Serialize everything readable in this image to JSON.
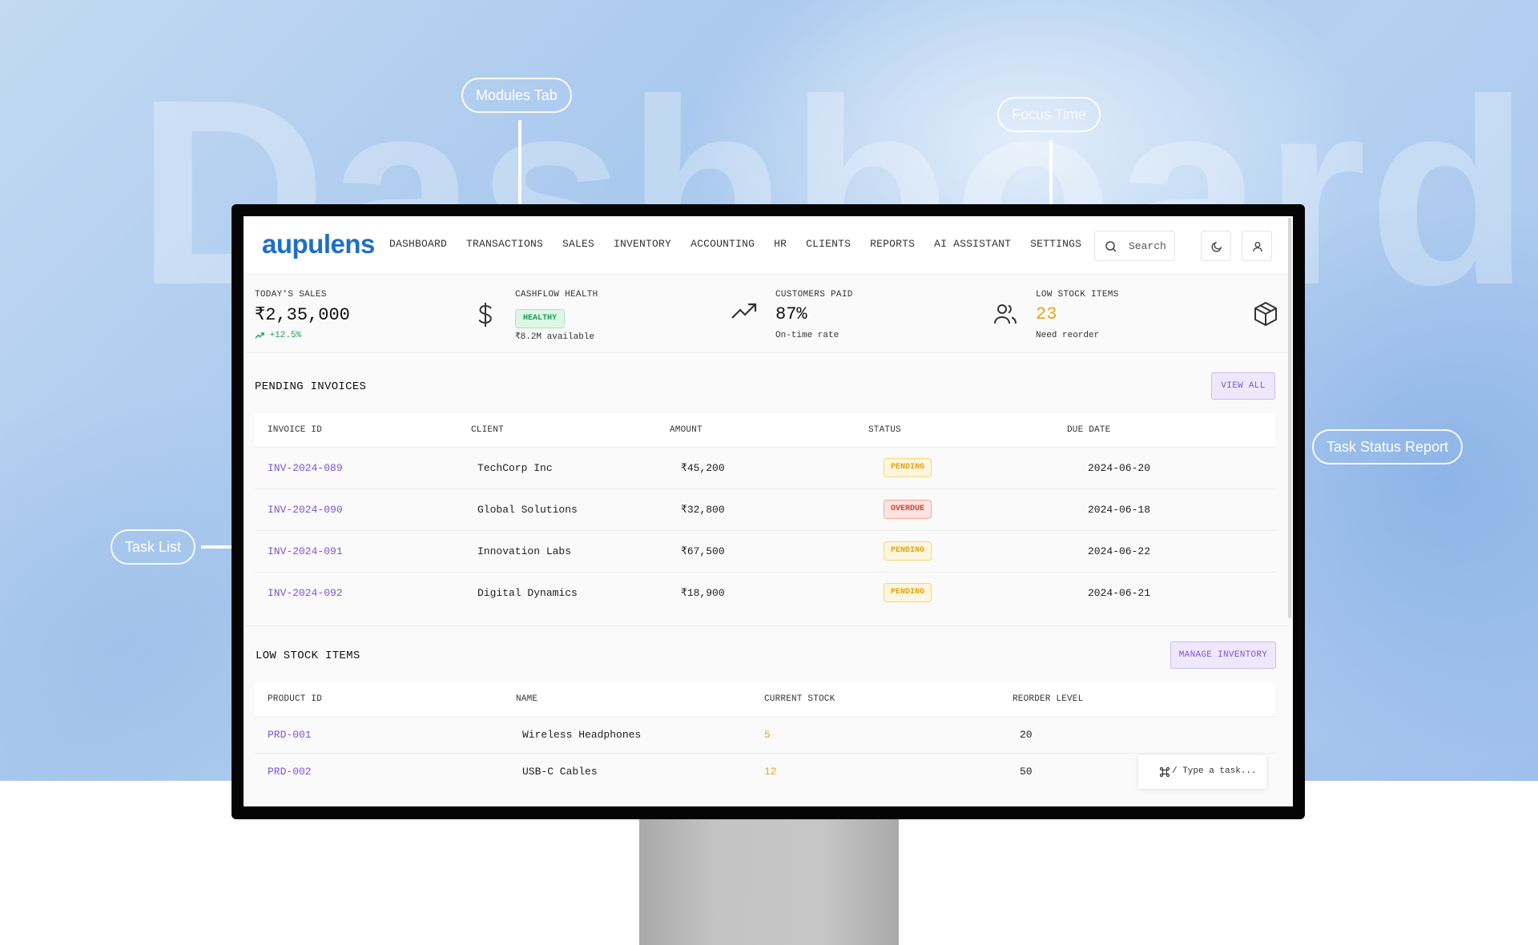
{
  "banner": {
    "watermark": "Dashboard",
    "callouts": {
      "modules_tab": "Modules Tab",
      "focus_time": "Focus Time",
      "task_status_report": "Task Status Report",
      "task_list": "Task List"
    }
  },
  "app": {
    "logo": "aupulens",
    "nav": [
      "DASHBOARD",
      "TRANSACTIONS",
      "SALES",
      "INVENTORY",
      "ACCOUNTING",
      "HR",
      "CLIENTS",
      "REPORTS",
      "AI ASSISTANT",
      "SETTINGS"
    ],
    "search_placeholder": "Search",
    "icons": {
      "search": "search-icon",
      "theme": "moon-icon",
      "profile": "user-icon"
    }
  },
  "stats": {
    "todays_sales": {
      "label": "TODAY'S SALES",
      "value": "₹2,35,000",
      "change": "+12.5%",
      "icon": "dollar-icon"
    },
    "cashflow": {
      "label": "CASHFLOW HEALTH",
      "badge": "HEALTHY",
      "sub": "₹8.2M available",
      "icon": "trending-up-icon"
    },
    "customers_paid": {
      "label": "CUSTOMERS PAID",
      "value": "87%",
      "sub": "On-time rate",
      "icon": "users-icon"
    },
    "low_stock": {
      "label": "LOW STOCK ITEMS",
      "value": "23",
      "sub": "Need reorder",
      "icon": "box-icon"
    }
  },
  "colors": {
    "accent": "#7b55d1",
    "brand": "#1e6ec8",
    "pending": "#e0a412",
    "overdue": "#d2432f",
    "healthy": "#1f9d55",
    "low_stock": "#e9a51a"
  },
  "pending_invoices": {
    "title": "PENDING INVOICES",
    "view_all": "VIEW ALL",
    "columns": [
      "INVOICE ID",
      "CLIENT",
      "AMOUNT",
      "STATUS",
      "DUE DATE"
    ],
    "rows": [
      {
        "id": "INV-2024-089",
        "client": "TechCorp Inc",
        "amount": "₹45,200",
        "status": "PENDING",
        "due": "2024-06-20"
      },
      {
        "id": "INV-2024-090",
        "client": "Global Solutions",
        "amount": "₹32,800",
        "status": "OVERDUE",
        "due": "2024-06-18"
      },
      {
        "id": "INV-2024-091",
        "client": "Innovation Labs",
        "amount": "₹67,500",
        "status": "PENDING",
        "due": "2024-06-22"
      },
      {
        "id": "INV-2024-092",
        "client": "Digital Dynamics",
        "amount": "₹18,900",
        "status": "PENDING",
        "due": "2024-06-21"
      }
    ]
  },
  "low_stock_items": {
    "title": "LOW STOCK ITEMS",
    "manage": "MANAGE INVENTORY",
    "columns": [
      "PRODUCT ID",
      "NAME",
      "CURRENT STOCK",
      "REORDER LEVEL"
    ],
    "rows": [
      {
        "id": "PRD-001",
        "name": "Wireless Headphones",
        "stock": "5",
        "reorder": "20"
      },
      {
        "id": "PRD-002",
        "name": "USB-C Cables",
        "stock": "12",
        "reorder": "50"
      }
    ]
  },
  "command_bar": {
    "placeholder": "/ Type a task...",
    "icon": "command-icon"
  }
}
